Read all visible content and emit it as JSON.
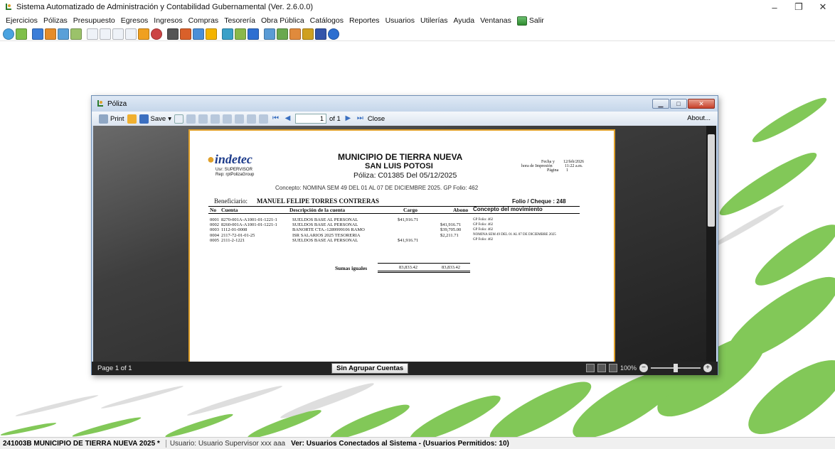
{
  "app": {
    "title": "Sistema Automatizado de Administración y Contabilidad Gubernamental  (Ver. 2.6.0.0)",
    "window_controls": [
      "–",
      "❐",
      "✕"
    ]
  },
  "menu": [
    "Ejercicios",
    "Pólizas",
    "Presupuesto",
    "Egresos",
    "Ingresos",
    "Compras",
    "Tesorería",
    "Obra Pública",
    "Catálogos",
    "Reportes",
    "Usuarios",
    "Utilerías",
    "Ayuda",
    "Ventanas"
  ],
  "menu_exit": "Salir",
  "report_window": {
    "title": "Póliza",
    "toolbar": {
      "print": "Print",
      "save": "Save",
      "page_value": "1",
      "page_of": "of 1",
      "close": "Close",
      "about": "About..."
    },
    "footer": {
      "page": "Page 1 of 1",
      "group_button": "Sin Agrupar Cuentas",
      "zoom": "100%"
    }
  },
  "report": {
    "logo": "indetec",
    "usr": "Usr: SUPERVISOR",
    "rep": "Rep: rptPolizaGroup",
    "entity": "MUNICIPIO DE TIERRA NUEVA",
    "state": "SAN LUIS POTOSI",
    "poliza": "Póliza:  C01385  Del 05/12/2025",
    "fecha_label": "Fecha y",
    "fecha_value": "12/feb/2026",
    "hora_label": "hora de Impresión",
    "hora_value": "11:22 a.m.",
    "pagina_label": "Página",
    "pagina_value": "1",
    "concepto": "Concepto: NOMINA SEM 49 DEL 01 AL 07 DE DICIEMBRE 2025. GP Folio: 462",
    "beneficiario_label": "Beneficiario:",
    "beneficiario": "MANUEL FELIPE TORRES CONTRERAS",
    "folio": "Folio / Cheque : 248",
    "headers": {
      "no": "No",
      "cuenta": "Cuenta",
      "descripcion": "Descripción de la cuenta",
      "cargo": "Cargo",
      "abono": "Abono",
      "concepto": "Concepto del movimiento"
    },
    "rows": [
      {
        "no": "0001",
        "cuenta": "8270-001A-A1001-01-1221-1",
        "descripcion": "SUELDOS BASE AL PERSONAL",
        "cargo": "$41,916.71",
        "abono": "",
        "concepto": "GP Folio: 462"
      },
      {
        "no": "0002",
        "cuenta": "8260-001A-A1001-01-1221-1",
        "descripcion": "SUELDOS BASE AL PERSONAL",
        "cargo": "",
        "abono": "$41,916.71",
        "concepto": "GP Folio: 462"
      },
      {
        "no": "0003",
        "cuenta": "1112-01-0008",
        "descripcion": "BANORTE CTA.-1289999106 RAMO",
        "cargo": "",
        "abono": "$39,705.00",
        "concepto": "GP Folio: 462"
      },
      {
        "no": "0004",
        "cuenta": "2117-72-01-01-25",
        "descripcion": "ISR SALARIOS 2025 TESORERIA",
        "cargo": "",
        "abono": "$2,211.71",
        "concepto": "NOMINA SEM 49 DEL 01 AL 07 DE DICIEMBRE 2025"
      },
      {
        "no": "0005",
        "cuenta": "2111-2-1221",
        "descripcion": "SUELDOS BASE AL PERSONAL",
        "cargo": "$41,916.71",
        "abono": "",
        "concepto": "GP Folio: 462"
      }
    ],
    "sumas_label": "Sumas iguales",
    "sumas_cargo": "83,833.42",
    "sumas_abono": "83,833.42"
  },
  "status": {
    "entity": "241003B MUNICIPIO DE TIERRA NUEVA  2025  *",
    "user": "Usuario: Usuario Supervisor xxx aaa",
    "connected": "Ver: Usuarios Conectados al Sistema - (Usuarios Permitidos: 10)"
  },
  "colors": {
    "accent_green": "#6cbf3a",
    "report_border": "#e0a02a",
    "window_title": "#c5d6ea"
  }
}
